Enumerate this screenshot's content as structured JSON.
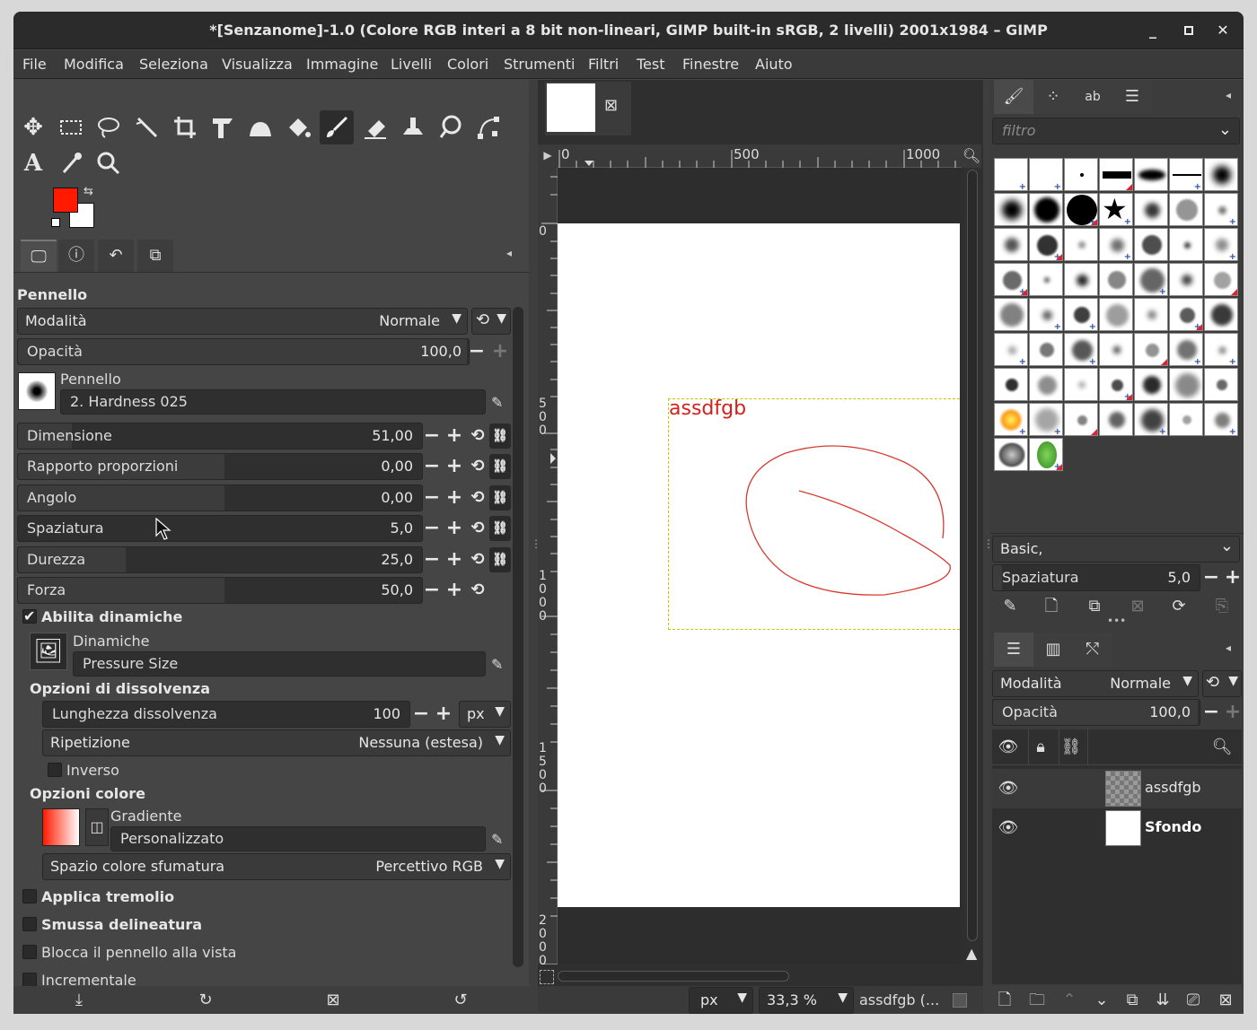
{
  "window": {
    "title": "*[Senzanome]-1.0 (Colore RGB interi a 8 bit non-lineari, GIMP built-in sRGB, 2 livelli) 2001x1984 – GIMP",
    "min": "_",
    "max": "□",
    "close": "✕"
  },
  "menu": [
    "File",
    "Modifica",
    "Seleziona",
    "Visualizza",
    "Immagine",
    "Livelli",
    "Colori",
    "Strumenti",
    "Filtri",
    "Test",
    "Finestre",
    "Aiuto"
  ],
  "colors": {
    "foreground": "#ff1a00",
    "background": "#ffffff",
    "accent_text": "#d4211b"
  },
  "tool_options": {
    "title": "Pennello",
    "mode_label": "Modalità",
    "mode_value": "Normale",
    "opacity_label": "Opacità",
    "opacity_value": "100,0",
    "brush_label": "Pennello",
    "brush_value": "2. Hardness 025",
    "sliders": [
      {
        "label": "Dimensione",
        "value": "51,00"
      },
      {
        "label": "Rapporto proporzioni",
        "value": "0,00"
      },
      {
        "label": "Angolo",
        "value": "0,00"
      },
      {
        "label": "Spaziatura",
        "value": "5,0"
      },
      {
        "label": "Durezza",
        "value": "25,0"
      },
      {
        "label": "Forza",
        "value": "50,0"
      }
    ],
    "dynamics_enable": "Abilita dinamiche",
    "dynamics_label": "Dinamiche",
    "dynamics_value": "Pressure Size",
    "fade_header": "Opzioni di dissolvenza",
    "fade_length_label": "Lunghezza dissolvenza",
    "fade_length_value": "100",
    "fade_unit": "px",
    "repeat_label": "Ripetizione",
    "repeat_value": "Nessuna (estesa)",
    "reverse_label": "Inverso",
    "color_header": "Opzioni colore",
    "gradient_label": "Gradiente",
    "gradient_value": "Personalizzato",
    "blend_space_label": "Spazio colore sfumatura",
    "blend_space_value": "Percettivo RGB",
    "jitter": "Applica tremolio",
    "smooth": "Smussa delineatura",
    "lock_view": "Blocca il pennello alla vista",
    "incremental": "Incrementale"
  },
  "canvas": {
    "hruler_ticks": [
      "0",
      "500",
      "1000"
    ],
    "vruler_ticks": [
      "0",
      "500",
      "1000",
      "1500",
      "2000"
    ],
    "layer_text": "assdfgb",
    "unit": "px",
    "zoom": "33,3 %",
    "status_text": "assdfgb (..."
  },
  "brushes": {
    "filter_placeholder": "filtro",
    "tag": "Basic,",
    "spacing_label": "Spaziatura",
    "spacing_value": "5,0"
  },
  "layers": {
    "mode_label": "Modalità",
    "mode_value": "Normale",
    "opacity_label": "Opacità",
    "opacity_value": "100,0",
    "items": [
      {
        "name": "assdfgb",
        "visible": true
      },
      {
        "name": "Sfondo",
        "visible": true
      }
    ]
  }
}
